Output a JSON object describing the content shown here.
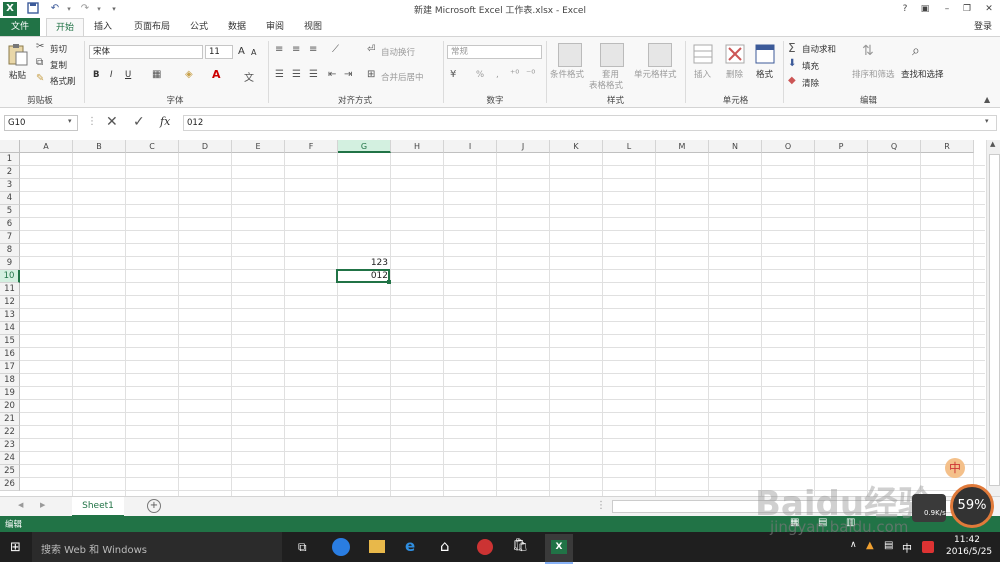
{
  "window": {
    "title": "新建 Microsoft Excel 工作表.xlsx - Excel",
    "help": "?",
    "login": "登录"
  },
  "qat": {
    "save_icon": "save-icon",
    "undo_icon": "undo-icon",
    "redo_icon": "redo-icon"
  },
  "tabs": [
    {
      "label": "文件"
    },
    {
      "label": "开始"
    },
    {
      "label": "插入"
    },
    {
      "label": "页面布局"
    },
    {
      "label": "公式"
    },
    {
      "label": "数据"
    },
    {
      "label": "审阅"
    },
    {
      "label": "视图"
    }
  ],
  "ribbon": {
    "clipboard": {
      "paste": "粘贴",
      "cut": "剪切",
      "copy": "复制",
      "format_painter": "格式刷",
      "label": "剪贴板"
    },
    "font": {
      "name": "宋体",
      "size": "11",
      "bold": "B",
      "italic": "I",
      "underline": "U",
      "grow": "A",
      "shrink": "A",
      "label": "字体",
      "font_color_letter": "A"
    },
    "alignment": {
      "wrap": "自动换行",
      "merge": "合并后居中",
      "label": "对齐方式"
    },
    "number": {
      "format": "常规",
      "percent": "%",
      "comma": ",",
      "label": "数字"
    },
    "styles": {
      "conditional": "条件格式",
      "table": "套用",
      "table2": "表格格式",
      "cell_styles": "单元格样式",
      "label": "样式"
    },
    "cells": {
      "insert": "插入",
      "delete": "删除",
      "format": "格式",
      "label": "单元格"
    },
    "editing": {
      "autosum": "自动求和",
      "fill": "填充",
      "clear": "清除",
      "sort": "排序和筛选",
      "find": "查找和选择",
      "label": "编辑"
    }
  },
  "formula_bar": {
    "name_box": "G10",
    "content": "012",
    "fx": "fx"
  },
  "grid": {
    "columns": [
      "A",
      "B",
      "C",
      "D",
      "E",
      "F",
      "G",
      "H",
      "I",
      "J",
      "K",
      "L",
      "M",
      "N",
      "O",
      "P",
      "Q",
      "R"
    ],
    "rows": [
      "1",
      "2",
      "3",
      "4",
      "5",
      "6",
      "7",
      "8",
      "9",
      "10",
      "11",
      "12",
      "13",
      "14",
      "15",
      "16",
      "17",
      "18",
      "19",
      "20",
      "21",
      "22",
      "23",
      "24",
      "25",
      "26"
    ],
    "active_column": "G",
    "active_row": "10",
    "cells": {
      "G9": "123",
      "G10": "012"
    }
  },
  "sheets": {
    "active": "Sheet1",
    "add": "+"
  },
  "status": {
    "mode": "编辑"
  },
  "taskbar": {
    "search": "搜索 Web 和 Windows",
    "time": "11:42",
    "date": "2016/5/25",
    "ime": "中"
  },
  "overlay": {
    "watermark": "Baidu经验",
    "watermark_url": "jingyan.baidu.com",
    "speed_percent": "59%",
    "speed": "0.9K/s",
    "ime_badge": "中"
  },
  "colors": {
    "accent": "#217346",
    "selection": "#217346"
  }
}
